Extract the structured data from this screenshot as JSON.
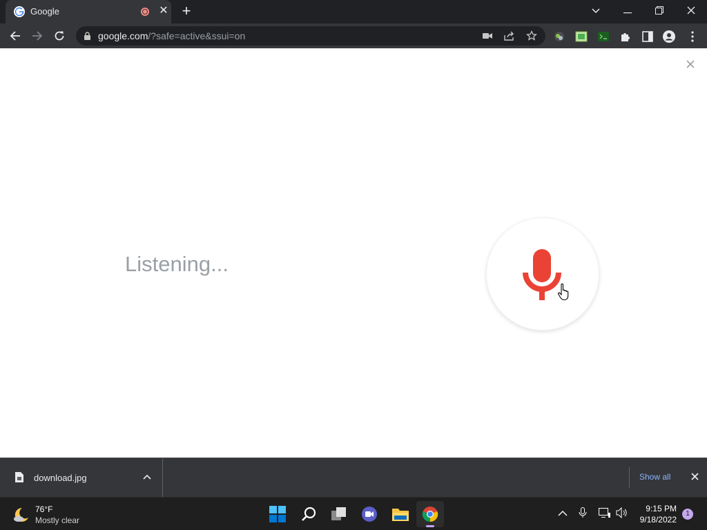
{
  "browser": {
    "tab": {
      "title": "Google"
    },
    "omnibox": {
      "host": "google.com",
      "path": "/?safe=active&ssui=on"
    },
    "colors": {
      "frame": "#202124",
      "toolbar": "#35363a",
      "accent_link": "#8ab4f8"
    }
  },
  "page": {
    "status_text": "Listening...",
    "mic_color": "#ea4335"
  },
  "download_shelf": {
    "filename": "download.jpg",
    "show_all_label": "Show all"
  },
  "taskbar": {
    "weather": {
      "temp": "76°F",
      "desc": "Mostly clear"
    },
    "apps": [
      "start",
      "search",
      "task-view",
      "meet",
      "file-explorer",
      "chrome"
    ],
    "clock": {
      "time": "9:15 PM",
      "date": "9/18/2022"
    },
    "notification_count": "1"
  }
}
